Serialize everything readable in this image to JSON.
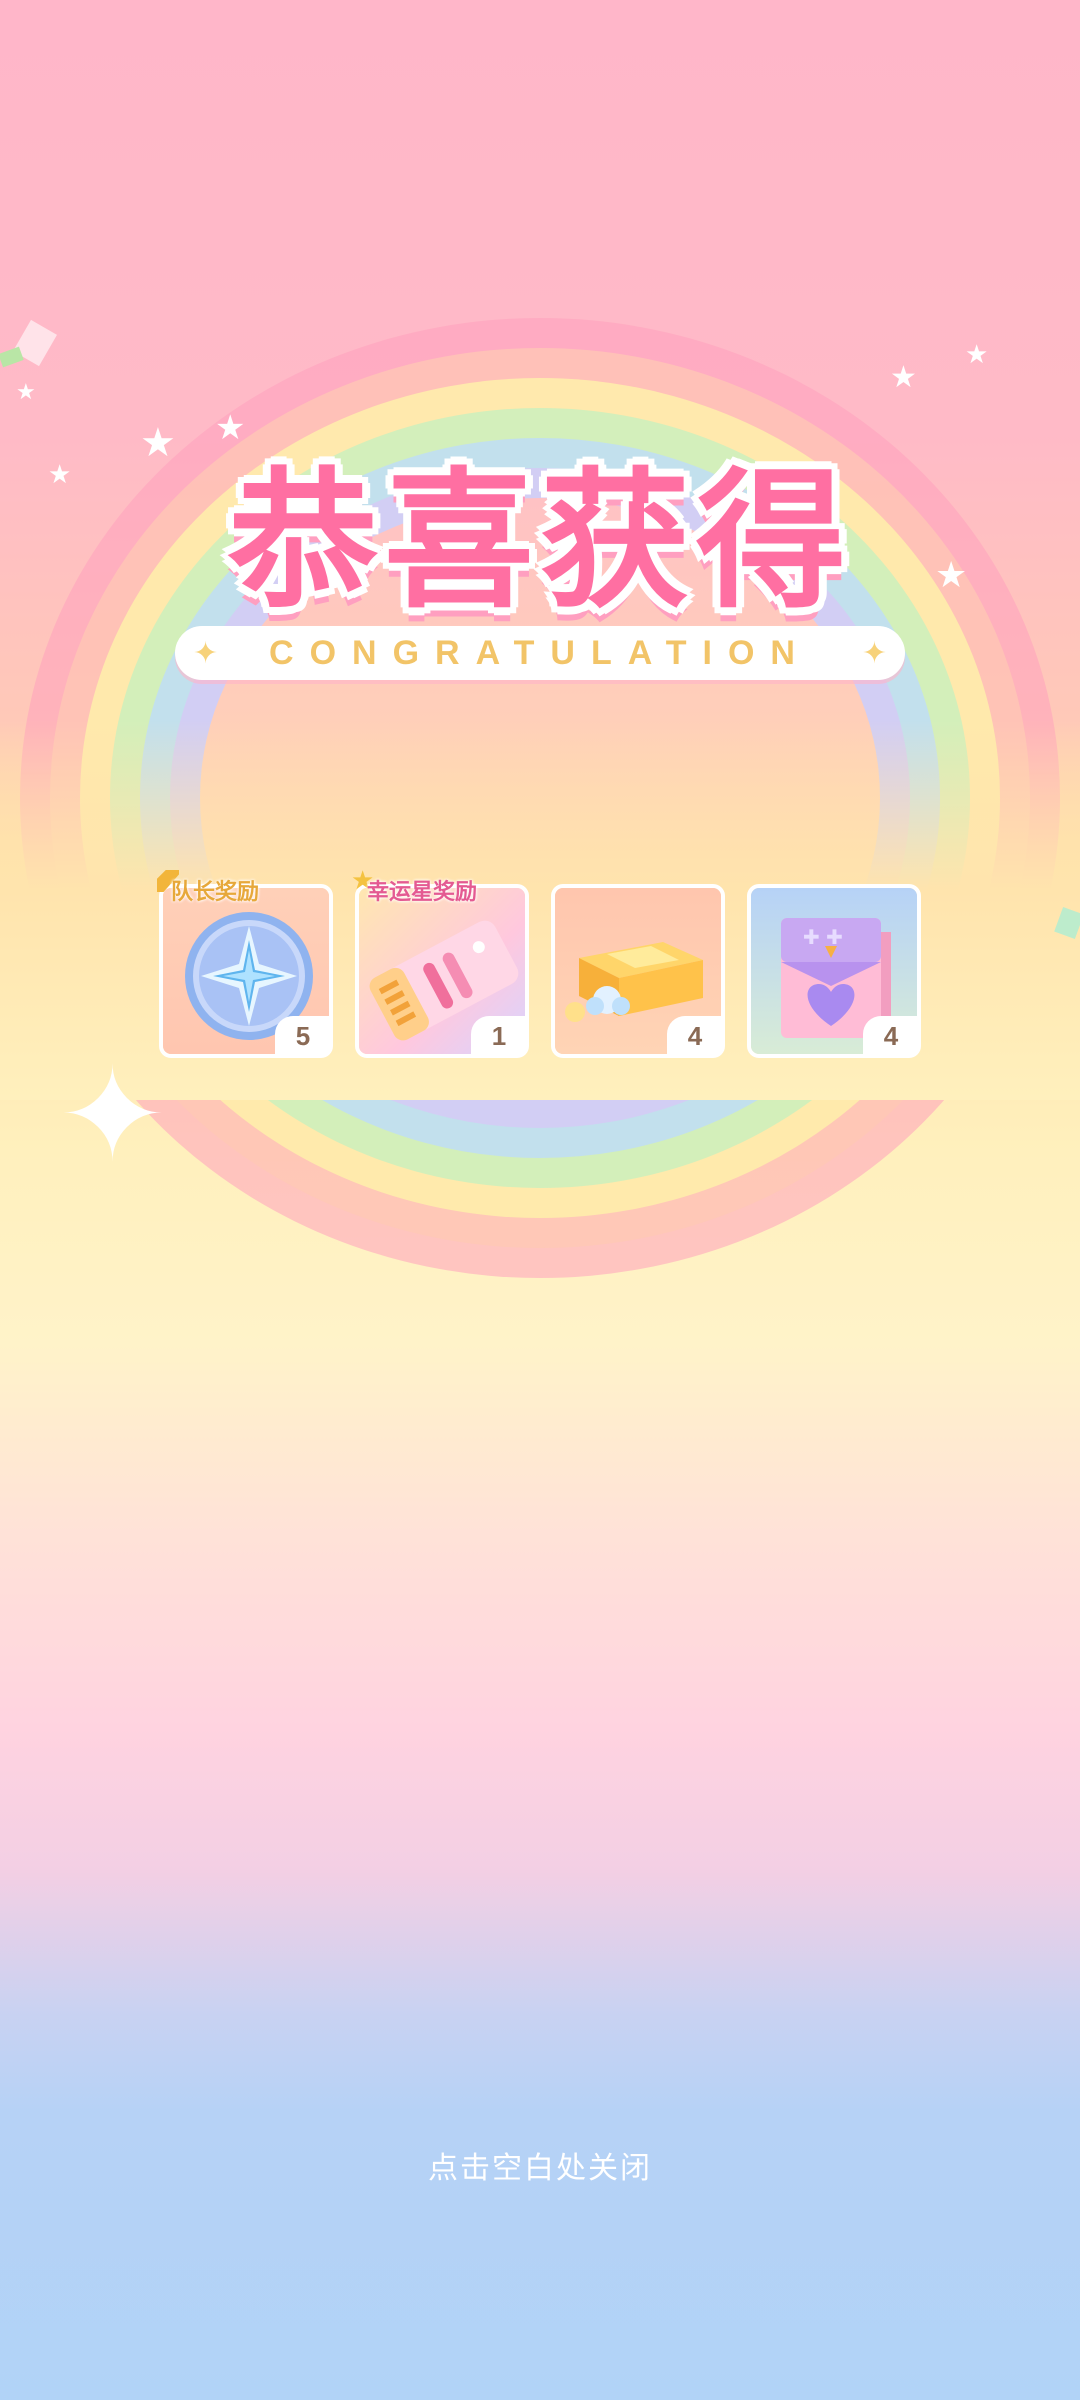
{
  "title": "恭喜获得",
  "subtitle": "CONGRATULATION",
  "rewards": [
    {
      "tag": "队长奖励",
      "icon": "star-medal-icon",
      "count": "5"
    },
    {
      "tag": "幸运星奖励",
      "icon": "ticket-icon",
      "count": "1"
    },
    {
      "tag": "",
      "icon": "gift-box-icon",
      "count": "4"
    },
    {
      "tag": "",
      "icon": "heart-bag-icon",
      "count": "4"
    }
  ],
  "close_hint": "点击空白处关闭",
  "colors": {
    "title_pink": "#ff6fa2",
    "subtitle_gold": "#f2c468",
    "captain_tag": "#e7a83a",
    "lucky_tag": "#e45a92"
  }
}
